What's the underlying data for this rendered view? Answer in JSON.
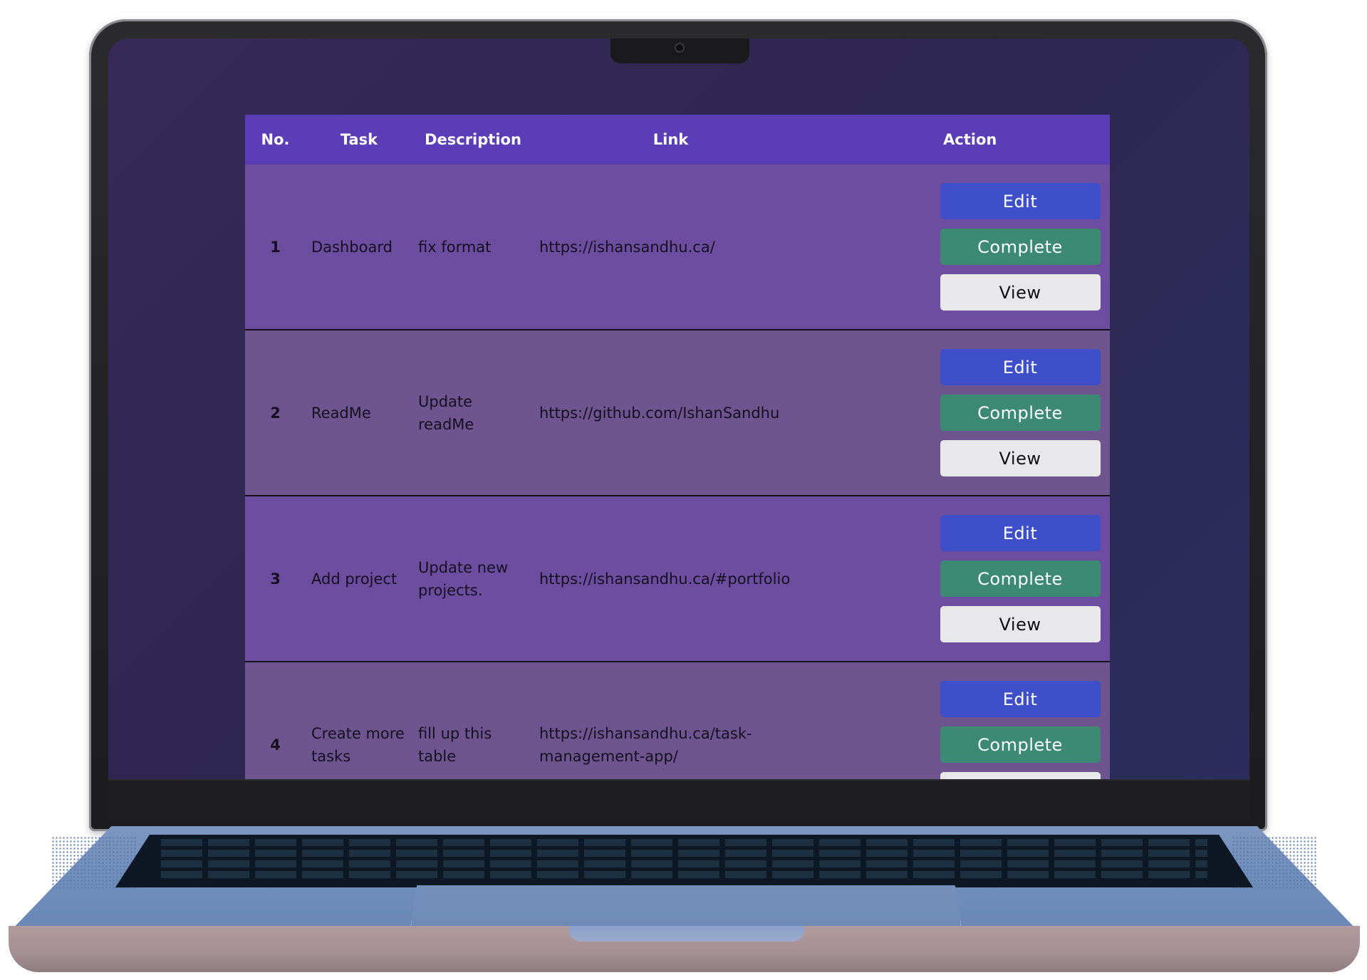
{
  "table": {
    "headers": {
      "number": "No.",
      "task": "Task",
      "description": "Description",
      "link": "Link",
      "action": "Action"
    },
    "rows": [
      {
        "number": "1",
        "task": "Dashboard",
        "description": "fix format",
        "link": "https://ishansandhu.ca/"
      },
      {
        "number": "2",
        "task": "ReadMe",
        "description": "Update readMe",
        "link": "https://github.com/IshanSandhu"
      },
      {
        "number": "3",
        "task": "Add project",
        "description": "Update new projects.",
        "link": "https://ishansandhu.ca/#portfolio"
      },
      {
        "number": "4",
        "task": "Create more tasks",
        "description": "fill up this table",
        "link": "https://ishansandhu.ca/task-management-app/"
      }
    ]
  },
  "actions": {
    "edit_label": "Edit",
    "complete_label": "Complete",
    "view_label": "View"
  },
  "colors": {
    "header": "#5a3db7",
    "row_odd": "#6d4da0",
    "row_even": "#6e5590",
    "edit": "#3f4fc9",
    "complete": "#3c8a74",
    "view": "#e8e8ea"
  }
}
